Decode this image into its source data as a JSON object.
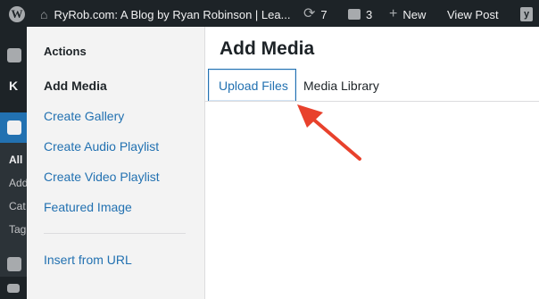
{
  "adminbar": {
    "wp_logo": "W",
    "site_title": "RyRob.com: A Blog by Ryan Robinson | Lea...",
    "updates_count": "7",
    "comments_count": "3",
    "new_label": "New",
    "view_post_label": "View Post",
    "yoast_letter": "y"
  },
  "adminmenu": {
    "letter_k": "K",
    "item_all": "All",
    "item_add": "Add",
    "item_cat": "Cat",
    "item_tag": "Tag"
  },
  "sidebar": {
    "heading": "Actions",
    "items": [
      {
        "label": "Add Media"
      },
      {
        "label": "Create Gallery"
      },
      {
        "label": "Create Audio Playlist"
      },
      {
        "label": "Create Video Playlist"
      },
      {
        "label": "Featured Image"
      },
      {
        "label": "Insert from URL"
      }
    ]
  },
  "content": {
    "title": "Add Media",
    "tabs": [
      {
        "label": "Upload Files"
      },
      {
        "label": "Media Library"
      }
    ]
  },
  "colors": {
    "accent": "#2271b1",
    "adminbar_bg": "#1d2327",
    "annotation_arrow": "#e8412c"
  }
}
